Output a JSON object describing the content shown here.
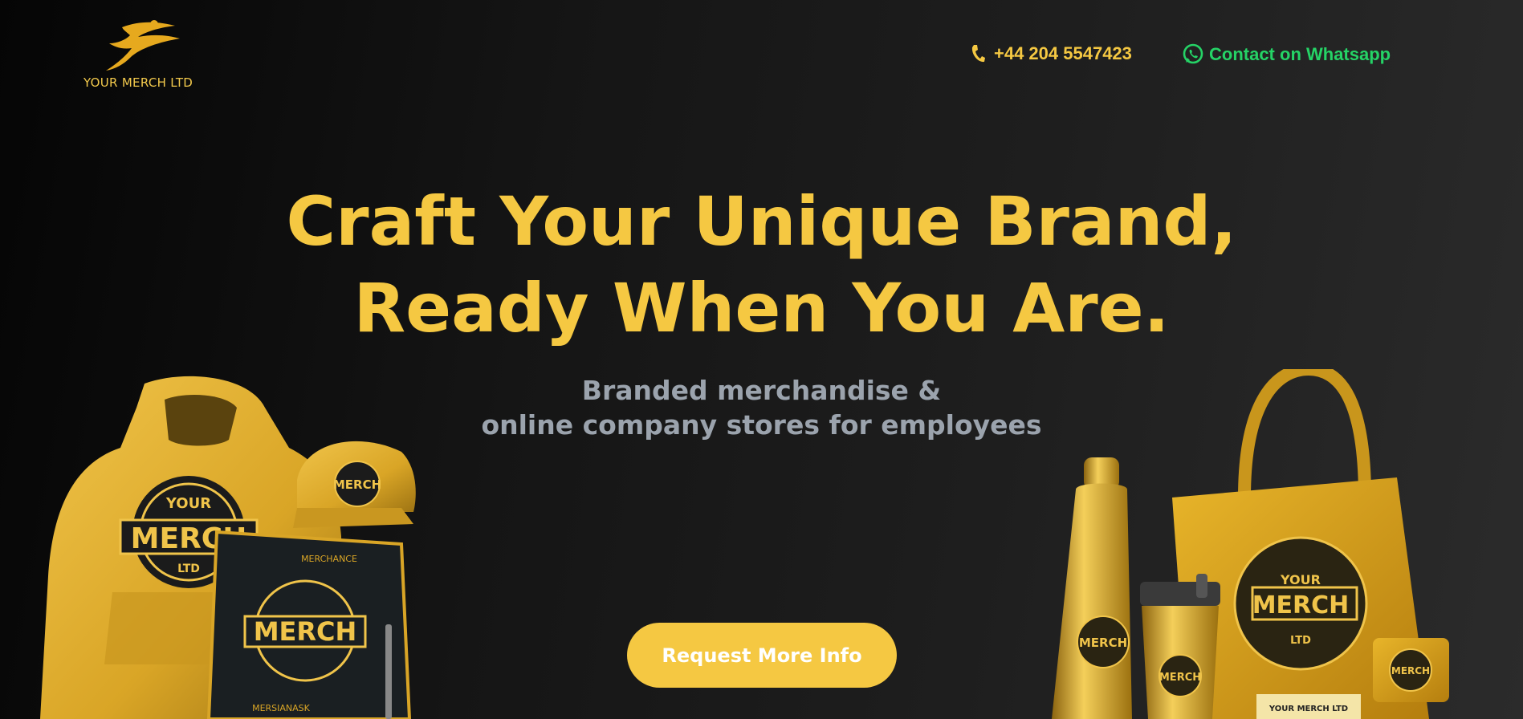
{
  "brand": {
    "logo_text": "YOUR MERCH LTD"
  },
  "header": {
    "phone": "+44 204 5547423",
    "whatsapp": "Contact on Whatsapp"
  },
  "hero": {
    "headline_line1": "Craft Your Unique Brand,",
    "headline_line2": "Ready When You Are.",
    "sub_line1": "Branded merchandise &",
    "sub_line2": "online company stores for employees",
    "cta": "Request More Info"
  },
  "illustrations": {
    "left": {
      "hoodie_badge_top": "YOUR",
      "hoodie_badge_main": "MERCH",
      "hoodie_badge_bottom": "LTD",
      "cap_badge": "MERCH",
      "notebook_badge": "MERCH",
      "notebook_header": "MERCHANCE",
      "notebook_footer": "MERSIANASK"
    },
    "right": {
      "bag_badge_top": "YOUR",
      "bag_badge_main": "MERCH",
      "bag_badge_bottom": "LTD",
      "bottle_badge": "MERCH",
      "tumbler_badge": "MERCH",
      "box_label": "YOUR MERCH LTD",
      "small_box_badge": "MERCH"
    }
  },
  "colors": {
    "accent": "#f5c842",
    "whatsapp": "#25d366",
    "subtext": "#9ba3ad"
  }
}
